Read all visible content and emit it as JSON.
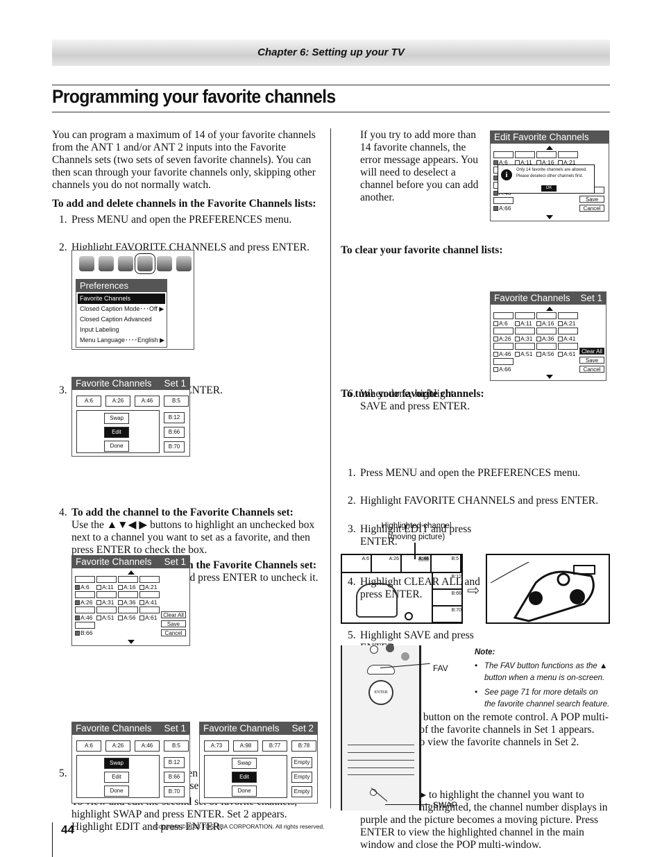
{
  "header": {
    "chapter": "Chapter 6: Setting up your TV"
  },
  "title": "Programming your favorite channels",
  "left": {
    "intro": "You can program a maximum of 14 of your favorite channels from the ANT 1 and/or ANT 2 inputs into the Favorite Channels sets (two sets of seven favorite channels). You can then scan through your favorite channels only, skipping other channels you do not normally watch.",
    "add_heading": "To add and delete channels in the Favorite Channels lists:",
    "step1": "Press MENU and open the PREFERENCES menu.",
    "step2": "Highlight FAVORITE CHANNELS and press ENTER.",
    "step3": "Highlight EDIT and press ENTER.",
    "step4_h": "To add the channel to the Favorite Channels set:",
    "step4_t": "Use the ▲▼◀ ▶ buttons to highlight an unchecked box next to a channel you want to set as a favorite, and then press ENTER to check the box.",
    "step4_h2": "To delete the channel from the Favorite Channels set:",
    "step4_t2": "Highlight a checked box and press ENTER to uncheck it.",
    "step5": "If you select more than seven favorite channels in step 4, the channels will be in two sets—Set 1 and Set 2.",
    "step5b": "To view and edit the second set of favorite channels, highlight SWAP and press ENTER. Set 2 appears. Highlight EDIT and press ENTER."
  },
  "right": {
    "error_text": "If you try to add more than 14 favorite channels, the error message appears. You will need to deselect a channel before you can add another.",
    "step6": "When done, highlight SAVE and press ENTER.",
    "clear_heading": "To clear your favorite channel lists:",
    "clear_steps": [
      "Press MENU and open the PREFERENCES menu.",
      "Highlight FAVORITE CHANNELS and press ENTER.",
      "Highlight EDIT and press ENTER.",
      "Highlight CLEAR ALL and press ENTER.",
      "Highlight SAVE and press ENTER."
    ],
    "tune_heading": "To tune your favorite channels:",
    "tune_steps": [
      "Press the FAV button on the remote control. A POP multi-window scan of the favorite channels in Set 1 appears. Press SWAP to view the favorite channels in Set 2.",
      "Press ▲▼◀ ▶ to highlight the channel you want to watch. When highlighted, the channel number displays in purple and the picture becomes a moving picture. Press ENTER to view the highlighted channel in the main window and close the POP multi-window."
    ],
    "highlight_caption_1": "Highlighted channel",
    "highlight_caption_2": "(moving picture)",
    "pop": {
      "top": [
        "A:6",
        "A:26",
        "A:46",
        "B:5"
      ],
      "side": [
        "B:12",
        "B:66",
        "B:70"
      ],
      "highlighted": "A:46"
    },
    "fav_label": "FAV",
    "swap_label": "SWAP",
    "note_title": "Note:",
    "notes": [
      "The FAV button functions as the ▲ button when a menu is on-screen.",
      "See page 71 for more details on the favorite channel search feature."
    ]
  },
  "panels": {
    "prefs": {
      "title": "Preferences",
      "items": [
        "Favorite Channels",
        "Closed Caption Mode･･･Off ▶",
        "Closed Caption Advanced",
        "Input Labeling",
        "Menu Language････English ▶"
      ],
      "selected": 0
    },
    "grid_a": {
      "title": "Favorite Channels",
      "set": "Set 1",
      "top": [
        "A:6",
        "A:26",
        "A:46",
        "B:5"
      ],
      "side": [
        "B:12",
        "B:66",
        "B:70"
      ],
      "buttons": [
        "Swap",
        "Edit",
        "Done"
      ],
      "selected": 1
    },
    "check_a": {
      "title": "Favorite Channels",
      "set": "Set 1",
      "rows": [
        [
          "A:6",
          "A:11",
          "A:16",
          "A:21"
        ],
        [
          "A:26",
          "A:31",
          "A:36",
          "A:41"
        ],
        [
          "A:46",
          "A:51",
          "A:56",
          "A:61"
        ],
        [
          "B:66"
        ]
      ],
      "checked": [
        "A:6",
        "A:26",
        "A:46",
        "B:66"
      ],
      "buttons": [
        "Clear All",
        "Save",
        "Cancel"
      ]
    },
    "grid_b": {
      "title": "Favorite Channels",
      "set": "Set 1",
      "top": [
        "A:6",
        "A:26",
        "A:46",
        "B:5"
      ],
      "side": [
        "B:12",
        "B:66",
        "B:70"
      ],
      "buttons": [
        "Swap",
        "Edit",
        "Done"
      ],
      "selected": 0
    },
    "grid_c": {
      "title": "Favorite Channels",
      "set": "Set 2",
      "top": [
        "A:73",
        "A:98",
        "B:77",
        "B:78"
      ],
      "side": [
        "Empty",
        "Empty",
        "Empty"
      ],
      "buttons": [
        "Swap",
        "Edit",
        "Done"
      ],
      "selected": 1
    },
    "edit": {
      "title": "Edit Favorite Channels",
      "rows": [
        [
          "A:6",
          "A:11",
          "A:16",
          "A:21"
        ],
        [
          "A:26"
        ],
        [
          "A:46"
        ],
        [
          "A:66"
        ]
      ],
      "checked": [
        "A:6",
        "A:26",
        "A:46",
        "A:66"
      ],
      "buttons": [
        "All",
        "Save",
        "Cancel"
      ],
      "dialog": [
        "Only 14 favorite channels are allowed.",
        "Please deselect other channels first."
      ],
      "ok": "OK"
    },
    "check_b": {
      "title": "Favorite Channels",
      "set": "Set 1",
      "rows": [
        [
          "A:6",
          "A:11",
          "A:16",
          "A:21"
        ],
        [
          "A:26",
          "A:31",
          "A:36",
          "A:41"
        ],
        [
          "A:46",
          "A:51",
          "A:56",
          "A:61"
        ],
        [
          "A:66"
        ]
      ],
      "checked": [],
      "buttons": [
        "Clear All",
        "Save",
        "Cancel"
      ],
      "selected": 0
    }
  },
  "footer": {
    "page": "44",
    "copyright": "Copyright © 2003 TOSHIBA CORPORATION. All rights reserved."
  }
}
